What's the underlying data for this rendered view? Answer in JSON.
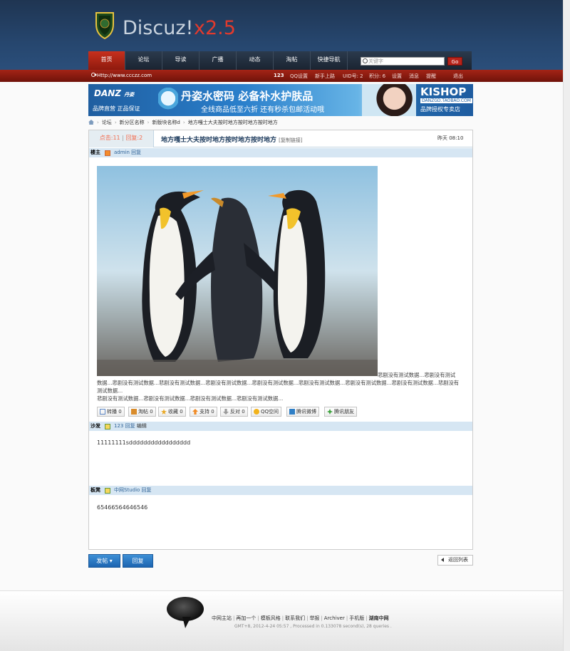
{
  "header": {
    "logo_text": "Discuz!",
    "logo_version": "x2.5",
    "nav": [
      {
        "label": "首页"
      },
      {
        "label": "论坛"
      },
      {
        "label": "导读"
      },
      {
        "label": "广播"
      },
      {
        "label": "动态"
      },
      {
        "label": "淘帖"
      },
      {
        "label": "快捷导航"
      }
    ],
    "search_placeholder": "关键字",
    "search_button": "Go",
    "site_url": "Http://www.ccczz.com",
    "user": {
      "name": "123",
      "links": [
        "QQ设置",
        "新手上路",
        "UID号: 2",
        "积分: 6",
        "设置",
        "消息",
        "提醒",
        "退出"
      ]
    }
  },
  "banner": {
    "brand": "DANZ",
    "brand_cn": "丹姿",
    "brand_sub": "品牌直营 正品保证",
    "headline": "丹姿水密码 必备补水护肤品",
    "subline": "全线商品低至六折 还有秒杀包邮活动哦",
    "shop": "KISHOP",
    "shop_site": "DANZGD.TAOBAO.COM",
    "shop_auth": "品牌授权专卖店"
  },
  "breadcrumb": [
    "论坛",
    "新分区名称",
    "新版块名称d",
    "地方嘎士大夫按时地方按时地方按时地方"
  ],
  "thread": {
    "views_label": "点击:11",
    "replies_label": "回复:2",
    "title": "地方嘎士大夫按时地方按时地方按时地方",
    "copy_link": "[复制链接]",
    "time": "昨天 08:10"
  },
  "posts": [
    {
      "floor": "楼主",
      "author": "admin",
      "action": "回复",
      "text_line1": "悲剧没有测试数据...悲剧没有测试",
      "text_line2": "数据...悲剧没有测试数据...悲剧没有测试数据...悲剧没有测试数据...悲剧没有测试数据...悲剧没有测试数据...悲剧没有测试数据...悲剧没有测试数据...悲剧没有测试数据...",
      "text_line3": "悲剧没有测试数据...悲剧没有测试数据...悲剧没有测试数据...悲剧没有测试数据..."
    },
    {
      "floor": "沙发",
      "author": "123",
      "action": "回复",
      "action2": "编辑",
      "content": "11111111sddddddddddddddddd"
    },
    {
      "floor": "板凳",
      "author": "中网Studio",
      "action": "回复",
      "content": "65466564646546"
    }
  ],
  "actions": [
    {
      "label": "转播 0",
      "icon": "share-icon",
      "color": "#5b86c5"
    },
    {
      "label": "淘帖 0",
      "icon": "collect-icon",
      "color": "#d98c2c"
    },
    {
      "label": "收藏 0",
      "icon": "star-icon",
      "color": "#e9a823"
    },
    {
      "label": "支持 0",
      "icon": "thumb-up-icon",
      "color": "#f08a24"
    },
    {
      "label": "反对 0",
      "icon": "thumb-down-icon",
      "color": "#9b9b9b"
    },
    {
      "label": "QQ空间",
      "icon": "qzone-icon",
      "color": "#f2b31c"
    },
    {
      "label": "腾讯微博",
      "icon": "weibo-icon",
      "color": "#2f7fc6"
    },
    {
      "label": "腾讯朋友",
      "icon": "friends-icon",
      "color": "#3fa33f"
    }
  ],
  "buttons": {
    "post": "发帖",
    "reply": "回复",
    "back": "返回列表"
  },
  "footer": {
    "links": [
      "中网主站",
      "再加一个",
      "模板风格",
      "联系我们",
      "举报",
      "Archiver",
      "手机版"
    ],
    "bold_link": "湖南中网",
    "meta": "GMT+8, 2012-4-24 05:57 , Processed in 0.133078 second(s), 28 queries ."
  }
}
